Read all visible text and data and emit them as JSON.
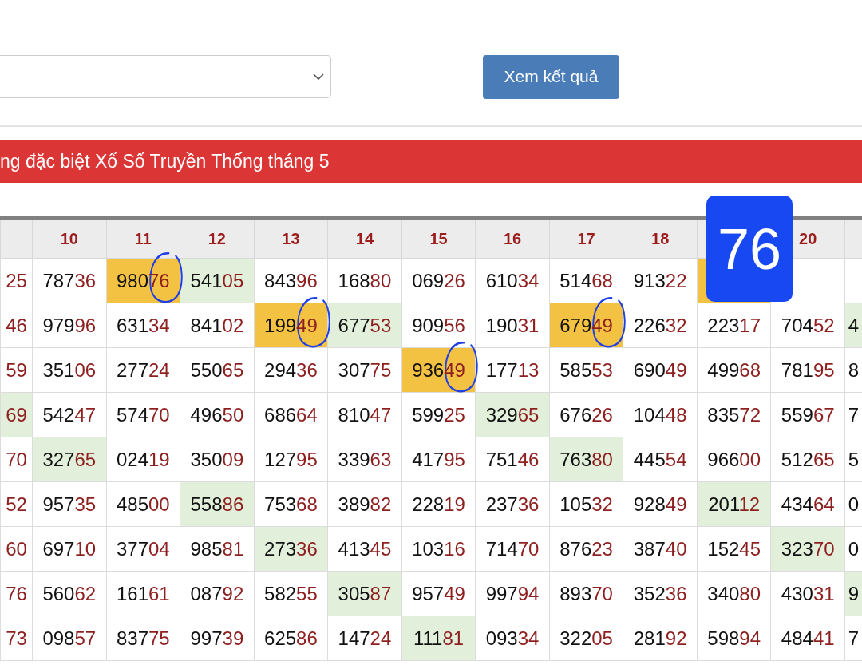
{
  "controls": {
    "button": "Xem kết quả"
  },
  "banner": {
    "title": "ng đặc biệt Xổ Số Truyền Thống tháng 5"
  },
  "overlay_badge": {
    "text": "76"
  },
  "table": {
    "columns": [
      {},
      {
        "label": "10"
      },
      {
        "label": "11"
      },
      {
        "label": "12"
      },
      {
        "label": "13"
      },
      {
        "label": "14"
      },
      {
        "label": "15"
      },
      {
        "label": "16"
      },
      {
        "label": "17"
      },
      {
        "label": "18"
      },
      {},
      {
        "label": "20"
      },
      {}
    ],
    "rows": [
      {
        "cells": [
          {
            "value": "25",
            "color": "#ffffff",
            "circled": false
          },
          {
            "value": "78736",
            "color": "#ffffff",
            "circled": false
          },
          {
            "value": "98076",
            "color": "#f4c243",
            "circled": true
          },
          {
            "value": "54105",
            "color": "#e2efda",
            "circled": false
          },
          {
            "value": "84396",
            "color": "#ffffff",
            "circled": false
          },
          {
            "value": "16880",
            "color": "#ffffff",
            "circled": false
          },
          {
            "value": "06926",
            "color": "#ffffff",
            "circled": false
          },
          {
            "value": "61034",
            "color": "#ffffff",
            "circled": false
          },
          {
            "value": "51468",
            "color": "#ffffff",
            "circled": false
          },
          {
            "value": "91322",
            "color": "#ffffff",
            "circled": false
          },
          {
            "color": "#f4c243",
            "circled": false
          },
          {
            "color": "#ffffff",
            "circled": false
          },
          {
            "color": "#ffffff",
            "circled": false
          }
        ]
      },
      {
        "cells": [
          {
            "value": "46",
            "color": "#ffffff",
            "circled": false
          },
          {
            "value": "97996",
            "color": "#ffffff",
            "circled": false
          },
          {
            "value": "63134",
            "color": "#ffffff",
            "circled": false
          },
          {
            "value": "84102",
            "color": "#ffffff",
            "circled": false
          },
          {
            "value": "19949",
            "color": "#f4c243",
            "circled": true
          },
          {
            "value": "67753",
            "color": "#e2efda",
            "circled": false
          },
          {
            "value": "90956",
            "color": "#ffffff",
            "circled": false
          },
          {
            "value": "19031",
            "color": "#ffffff",
            "circled": false
          },
          {
            "value": "67949",
            "color": "#f4c243",
            "circled": true
          },
          {
            "value": "22632",
            "color": "#ffffff",
            "circled": false
          },
          {
            "value": "22317",
            "color": "#ffffff",
            "circled": false
          },
          {
            "value": "70452",
            "color": "#ffffff",
            "circled": false
          },
          {
            "value": "4",
            "color": "#e2efda",
            "circled": false
          }
        ]
      },
      {
        "cells": [
          {
            "value": "59",
            "color": "#ffffff",
            "circled": false
          },
          {
            "value": "35106",
            "color": "#ffffff",
            "circled": false
          },
          {
            "value": "27724",
            "color": "#ffffff",
            "circled": false
          },
          {
            "value": "55065",
            "color": "#ffffff",
            "circled": false
          },
          {
            "value": "29436",
            "color": "#ffffff",
            "circled": false
          },
          {
            "value": "30775",
            "color": "#ffffff",
            "circled": false
          },
          {
            "value": "93649",
            "color": "#f4c243",
            "circled": true
          },
          {
            "value": "17713",
            "color": "#ffffff",
            "circled": false
          },
          {
            "value": "58553",
            "color": "#ffffff",
            "circled": false
          },
          {
            "value": "69049",
            "color": "#ffffff",
            "circled": false
          },
          {
            "value": "49968",
            "color": "#ffffff",
            "circled": false
          },
          {
            "value": "78195",
            "color": "#ffffff",
            "circled": false
          },
          {
            "value": "8",
            "color": "#ffffff",
            "circled": false
          }
        ]
      },
      {
        "cells": [
          {
            "value": "69",
            "color": "#e2efda",
            "circled": false
          },
          {
            "value": "54247",
            "color": "#ffffff",
            "circled": false
          },
          {
            "value": "57470",
            "color": "#ffffff",
            "circled": false
          },
          {
            "value": "49650",
            "color": "#ffffff",
            "circled": false
          },
          {
            "value": "68664",
            "color": "#ffffff",
            "circled": false
          },
          {
            "value": "81047",
            "color": "#ffffff",
            "circled": false
          },
          {
            "value": "59925",
            "color": "#ffffff",
            "circled": false
          },
          {
            "value": "32965",
            "color": "#e2efda",
            "circled": false
          },
          {
            "value": "67626",
            "color": "#ffffff",
            "circled": false
          },
          {
            "value": "10448",
            "color": "#ffffff",
            "circled": false
          },
          {
            "value": "83572",
            "color": "#ffffff",
            "circled": false
          },
          {
            "value": "55967",
            "color": "#ffffff",
            "circled": false
          },
          {
            "value": "7",
            "color": "#ffffff",
            "circled": false
          }
        ]
      },
      {
        "cells": [
          {
            "value": "70",
            "color": "#ffffff",
            "circled": false
          },
          {
            "value": "32765",
            "color": "#e2efda",
            "circled": false
          },
          {
            "value": "02419",
            "color": "#ffffff",
            "circled": false
          },
          {
            "value": "35009",
            "color": "#ffffff",
            "circled": false
          },
          {
            "value": "12795",
            "color": "#ffffff",
            "circled": false
          },
          {
            "value": "33963",
            "color": "#ffffff",
            "circled": false
          },
          {
            "value": "41795",
            "color": "#ffffff",
            "circled": false
          },
          {
            "value": "75146",
            "color": "#ffffff",
            "circled": false
          },
          {
            "value": "76380",
            "color": "#e2efda",
            "circled": false
          },
          {
            "value": "44554",
            "color": "#ffffff",
            "circled": false
          },
          {
            "value": "96600",
            "color": "#ffffff",
            "circled": false
          },
          {
            "value": "51265",
            "color": "#ffffff",
            "circled": false
          },
          {
            "value": "5",
            "color": "#ffffff",
            "circled": false
          }
        ]
      },
      {
        "cells": [
          {
            "value": "52",
            "color": "#ffffff",
            "circled": false
          },
          {
            "value": "95735",
            "color": "#ffffff",
            "circled": false
          },
          {
            "value": "48500",
            "color": "#ffffff",
            "circled": false
          },
          {
            "value": "55886",
            "color": "#e2efda",
            "circled": false
          },
          {
            "value": "75368",
            "color": "#ffffff",
            "circled": false
          },
          {
            "value": "38982",
            "color": "#ffffff",
            "circled": false
          },
          {
            "value": "22819",
            "color": "#ffffff",
            "circled": false
          },
          {
            "value": "23736",
            "color": "#ffffff",
            "circled": false
          },
          {
            "value": "10532",
            "color": "#ffffff",
            "circled": false
          },
          {
            "value": "92849",
            "color": "#ffffff",
            "circled": false
          },
          {
            "value": "20112",
            "color": "#e2efda",
            "circled": false
          },
          {
            "value": "43464",
            "color": "#ffffff",
            "circled": false
          },
          {
            "value": "0",
            "color": "#ffffff",
            "circled": false
          }
        ]
      },
      {
        "cells": [
          {
            "value": "60",
            "color": "#ffffff",
            "circled": false
          },
          {
            "value": "69710",
            "color": "#ffffff",
            "circled": false
          },
          {
            "value": "37704",
            "color": "#ffffff",
            "circled": false
          },
          {
            "value": "98581",
            "color": "#ffffff",
            "circled": false
          },
          {
            "value": "27336",
            "color": "#e2efda",
            "circled": false
          },
          {
            "value": "41345",
            "color": "#ffffff",
            "circled": false
          },
          {
            "value": "10316",
            "color": "#ffffff",
            "circled": false
          },
          {
            "value": "71470",
            "color": "#ffffff",
            "circled": false
          },
          {
            "value": "87623",
            "color": "#ffffff",
            "circled": false
          },
          {
            "value": "38740",
            "color": "#ffffff",
            "circled": false
          },
          {
            "value": "15245",
            "color": "#ffffff",
            "circled": false
          },
          {
            "value": "32370",
            "color": "#e2efda",
            "circled": false
          },
          {
            "value": "0",
            "color": "#ffffff",
            "circled": false
          }
        ]
      },
      {
        "cells": [
          {
            "value": "76",
            "color": "#ffffff",
            "circled": false
          },
          {
            "value": "56062",
            "color": "#ffffff",
            "circled": false
          },
          {
            "value": "16161",
            "color": "#ffffff",
            "circled": false
          },
          {
            "value": "08792",
            "color": "#ffffff",
            "circled": false
          },
          {
            "value": "58255",
            "color": "#ffffff",
            "circled": false
          },
          {
            "value": "30587",
            "color": "#e2efda",
            "circled": false
          },
          {
            "value": "95749",
            "color": "#ffffff",
            "circled": false
          },
          {
            "value": "99794",
            "color": "#ffffff",
            "circled": false
          },
          {
            "value": "89370",
            "color": "#ffffff",
            "circled": false
          },
          {
            "value": "35236",
            "color": "#ffffff",
            "circled": false
          },
          {
            "value": "34080",
            "color": "#ffffff",
            "circled": false
          },
          {
            "value": "43031",
            "color": "#ffffff",
            "circled": false
          },
          {
            "value": "9",
            "color": "#e2efda",
            "circled": false
          }
        ]
      },
      {
        "cells": [
          {
            "value": "73",
            "color": "#ffffff",
            "circled": false
          },
          {
            "value": "09857",
            "color": "#ffffff",
            "circled": false
          },
          {
            "value": "83775",
            "color": "#ffffff",
            "circled": false
          },
          {
            "value": "99739",
            "color": "#ffffff",
            "circled": false
          },
          {
            "value": "62586",
            "color": "#ffffff",
            "circled": false
          },
          {
            "value": "14724",
            "color": "#ffffff",
            "circled": false
          },
          {
            "value": "11181",
            "color": "#e2efda",
            "circled": false
          },
          {
            "value": "09334",
            "color": "#ffffff",
            "circled": false
          },
          {
            "value": "32205",
            "color": "#ffffff",
            "circled": false
          },
          {
            "value": "28192",
            "color": "#ffffff",
            "circled": false
          },
          {
            "value": "59894",
            "color": "#ffffff",
            "circled": false
          },
          {
            "value": "48441",
            "color": "#ffffff",
            "circled": false
          },
          {
            "value": "7",
            "color": "#ffffff",
            "circled": false
          }
        ]
      }
    ]
  }
}
